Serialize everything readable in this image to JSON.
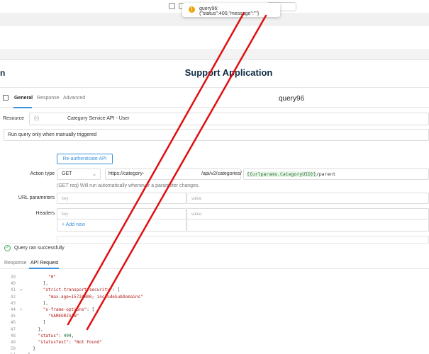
{
  "toast": {
    "message": "query96: {\"status\":400,\"message\":\"\"}"
  },
  "topbar": {
    "select_value": "n"
  },
  "app": {
    "title": "Support Application"
  },
  "panel": {
    "tabs": [
      "General",
      "Response",
      "Advanced"
    ],
    "query_name": "query96"
  },
  "resource": {
    "label": "Resource",
    "icon_text": "{-}",
    "value": "Category Service API - User"
  },
  "trigger": {
    "value": "Run query only when manually triggered"
  },
  "reauth_button": "Re-authenticate API",
  "action": {
    "label": "Action type",
    "method": "GET",
    "url_base": "https://category-",
    "url_path": "/api/v2/categories/",
    "url_param": "{{urlparams.CategoryUID}}",
    "url_suffix": "/parent",
    "hint": "(GET req) Will run automatically whenever a parameter changes."
  },
  "url_parameters": {
    "label": "URL parameters",
    "key_placeholder": "key",
    "value_placeholder": "value"
  },
  "headers": {
    "label": "Headers",
    "key_placeholder": "key",
    "value_placeholder": "value",
    "add_new": "+ Add new"
  },
  "status": {
    "text": "Query ran successfully"
  },
  "response_tabs": [
    "Response",
    "API Request"
  ],
  "code": [
    {
      "n": "39",
      "fold": "",
      "indent": 10,
      "parts": [
        [
          "str",
          "\"0\""
        ]
      ]
    },
    {
      "n": "40",
      "fold": "",
      "indent": 8,
      "parts": [
        [
          "punc",
          "],"
        ]
      ]
    },
    {
      "n": "41",
      "fold": "▾",
      "indent": 8,
      "parts": [
        [
          "str",
          "\"strict-transport-security\""
        ],
        [
          "punc",
          ": ["
        ]
      ]
    },
    {
      "n": "42",
      "fold": "",
      "indent": 10,
      "parts": [
        [
          "str",
          "\"max-age=15724800; includeSubDomains\""
        ]
      ]
    },
    {
      "n": "43",
      "fold": "",
      "indent": 8,
      "parts": [
        [
          "punc",
          "],"
        ]
      ]
    },
    {
      "n": "44",
      "fold": "▾",
      "indent": 8,
      "parts": [
        [
          "str",
          "\"x-frame-options\""
        ],
        [
          "punc",
          ": ["
        ]
      ]
    },
    {
      "n": "45",
      "fold": "",
      "indent": 10,
      "parts": [
        [
          "str",
          "\"SAMEORIGIN\""
        ]
      ]
    },
    {
      "n": "46",
      "fold": "",
      "indent": 8,
      "parts": [
        [
          "punc",
          "]"
        ]
      ]
    },
    {
      "n": "47",
      "fold": "",
      "indent": 6,
      "parts": [
        [
          "punc",
          "},"
        ]
      ]
    },
    {
      "n": "48",
      "fold": "",
      "indent": 6,
      "parts": [
        [
          "str",
          "\"status\""
        ],
        [
          "punc",
          ": "
        ],
        [
          "num",
          "404"
        ],
        [
          "punc",
          ","
        ]
      ]
    },
    {
      "n": "49",
      "fold": "",
      "indent": 6,
      "parts": [
        [
          "str",
          "\"statusText\""
        ],
        [
          "punc",
          ": "
        ],
        [
          "str",
          "\"Not Found\""
        ]
      ]
    },
    {
      "n": "50",
      "fold": "",
      "indent": 4,
      "parts": [
        [
          "punc",
          "}"
        ]
      ]
    },
    {
      "n": "51",
      "fold": "",
      "indent": 2,
      "parts": [
        [
          "punc",
          "}"
        ]
      ]
    }
  ],
  "colors": {
    "accent": "#3c92dc",
    "title": "#0f2a43",
    "success": "#3caa5a",
    "warning": "#f0a30a",
    "annotation": "#e01010"
  }
}
